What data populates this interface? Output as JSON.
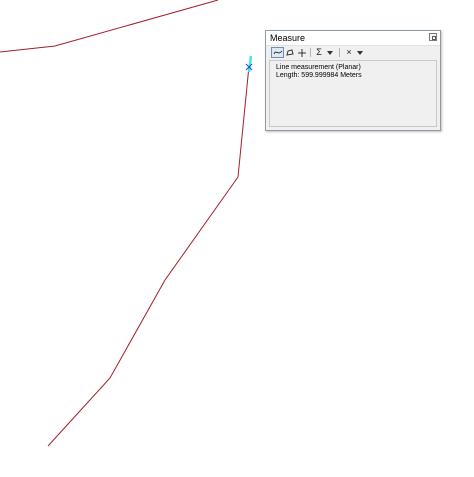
{
  "map": {
    "line_color": "#a0202a",
    "highlight_color": "#3ee6f0"
  },
  "measure": {
    "title": "Measure",
    "toolbar": {
      "measure_line_icon": "line-measure-icon",
      "measure_area_icon": "area-measure-icon",
      "measure_feature_icon": "feature-measure-icon",
      "sum_label": "Σ",
      "clear_label": "×"
    },
    "result": {
      "mode": "Line measurement (Planar)",
      "length": "Length: 599.999984 Meters"
    }
  }
}
